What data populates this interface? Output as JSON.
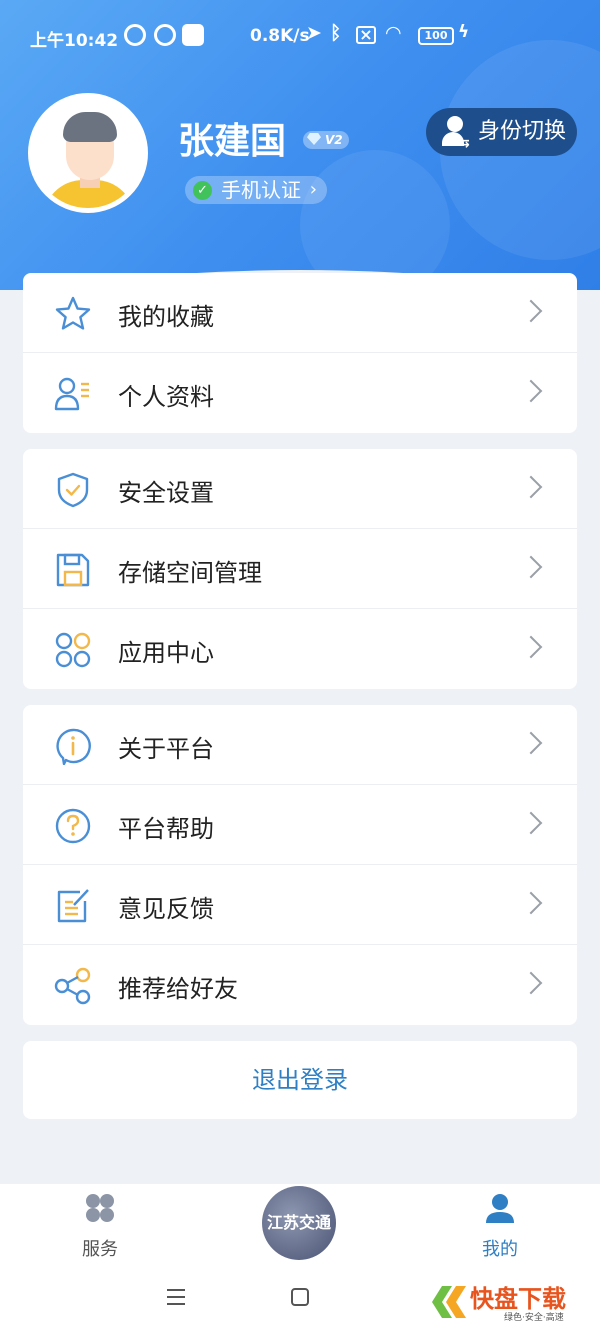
{
  "status_bar": {
    "time": "上午10:42",
    "net_speed": "0.8K/s",
    "battery": "100"
  },
  "profile": {
    "name": "张建国",
    "level": "V2",
    "verify_label": "手机认证",
    "switch_label": "身份切换"
  },
  "menu_groups": [
    {
      "items": [
        {
          "label": "我的收藏",
          "icon": "star-icon"
        },
        {
          "label": "个人资料",
          "icon": "profile-icon"
        }
      ]
    },
    {
      "items": [
        {
          "label": "安全设置",
          "icon": "shield-icon"
        },
        {
          "label": "存储空间管理",
          "icon": "save-icon"
        },
        {
          "label": "应用中心",
          "icon": "apps-icon"
        }
      ]
    },
    {
      "items": [
        {
          "label": "关于平台",
          "icon": "info-icon"
        },
        {
          "label": "平台帮助",
          "icon": "help-icon"
        },
        {
          "label": "意见反馈",
          "icon": "feedback-icon"
        },
        {
          "label": "推荐给好友",
          "icon": "share-icon"
        }
      ]
    }
  ],
  "logout_label": "退出登录",
  "tabbar": {
    "service_label": "服务",
    "center_label": "江苏交通",
    "mine_label": "我的"
  },
  "colors": {
    "primary": "#3f8ff0",
    "accent_text": "#2e7fc4",
    "active_tab": "#2e7fc4",
    "icon_blue": "#4a8fd6",
    "icon_yellow": "#f2b84b"
  },
  "watermark": {
    "text": "快盘下载",
    "subtext": "绿色·安全·高速"
  }
}
